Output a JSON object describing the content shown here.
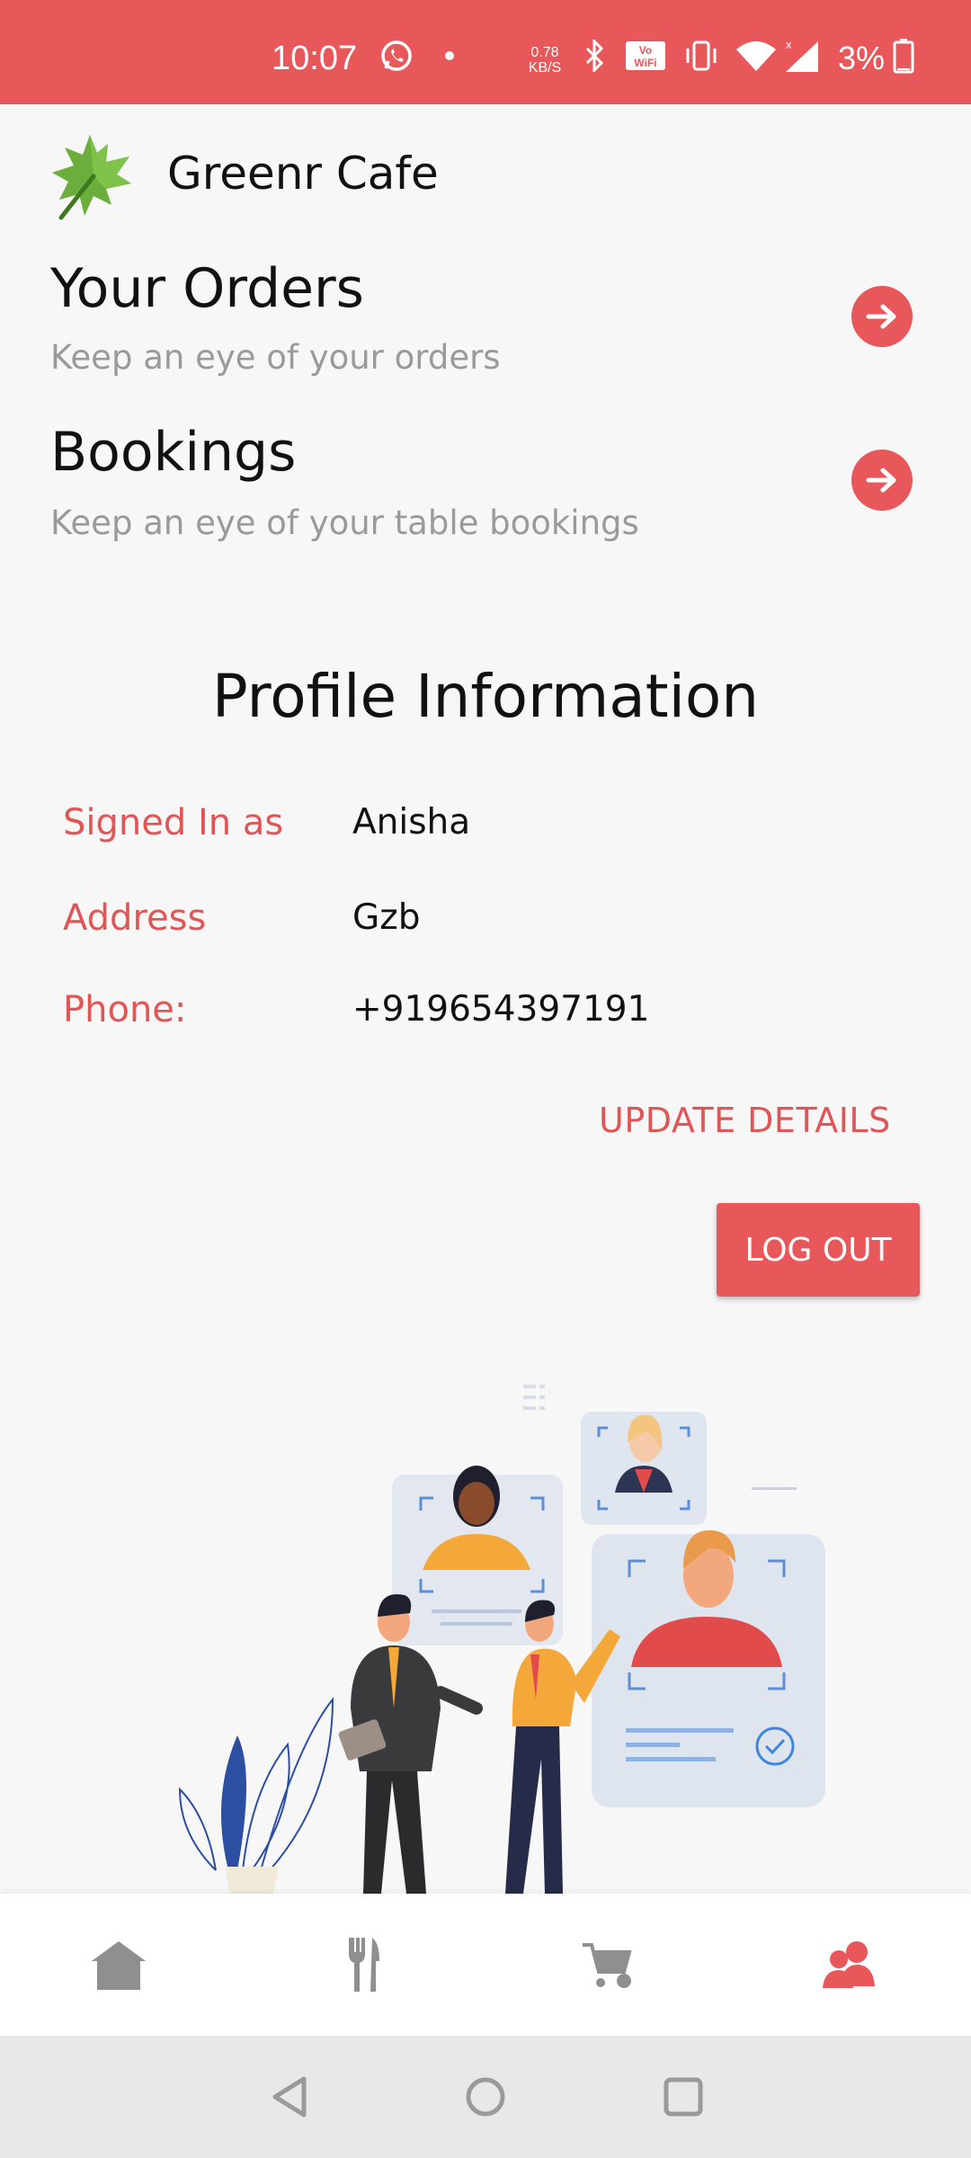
{
  "status_bar": {
    "time": "10:07",
    "network_speed_value": "0.78",
    "network_speed_unit": "KB/S",
    "battery_percent": "3%",
    "icons": [
      "whatsapp-icon",
      "dot-icon",
      "bluetooth-icon",
      "vowifi-icon",
      "vibrate-icon",
      "wifi-icon",
      "signal-icon",
      "battery-icon"
    ]
  },
  "header": {
    "app_title": "Greenr Cafe",
    "logo_icon": "maple-leaf-icon"
  },
  "sections": {
    "orders": {
      "title": "Your Orders",
      "subtitle": "Keep an eye of your orders"
    },
    "bookings": {
      "title": "Bookings",
      "subtitle": "Keep an eye of your table bookings"
    }
  },
  "profile": {
    "heading": "Profile Information",
    "fields": [
      {
        "label": "Signed In as",
        "value": "Anisha"
      },
      {
        "label": "Address",
        "value": "Gzb"
      },
      {
        "label": "Phone:",
        "value": "+919654397191"
      }
    ],
    "update_label": "UPDATE DETAILS",
    "logout_label": "LOG OUT"
  },
  "bottom_nav": {
    "items": [
      {
        "icon": "home-icon",
        "active": false
      },
      {
        "icon": "fork-knife-icon",
        "active": false
      },
      {
        "icon": "cart-icon",
        "active": false
      },
      {
        "icon": "profile-icon",
        "active": true
      }
    ]
  },
  "colors": {
    "accent": "#e8585a",
    "label_red": "#e05656",
    "muted": "#9a9a9a",
    "nav_inactive": "#8f8f8f"
  }
}
